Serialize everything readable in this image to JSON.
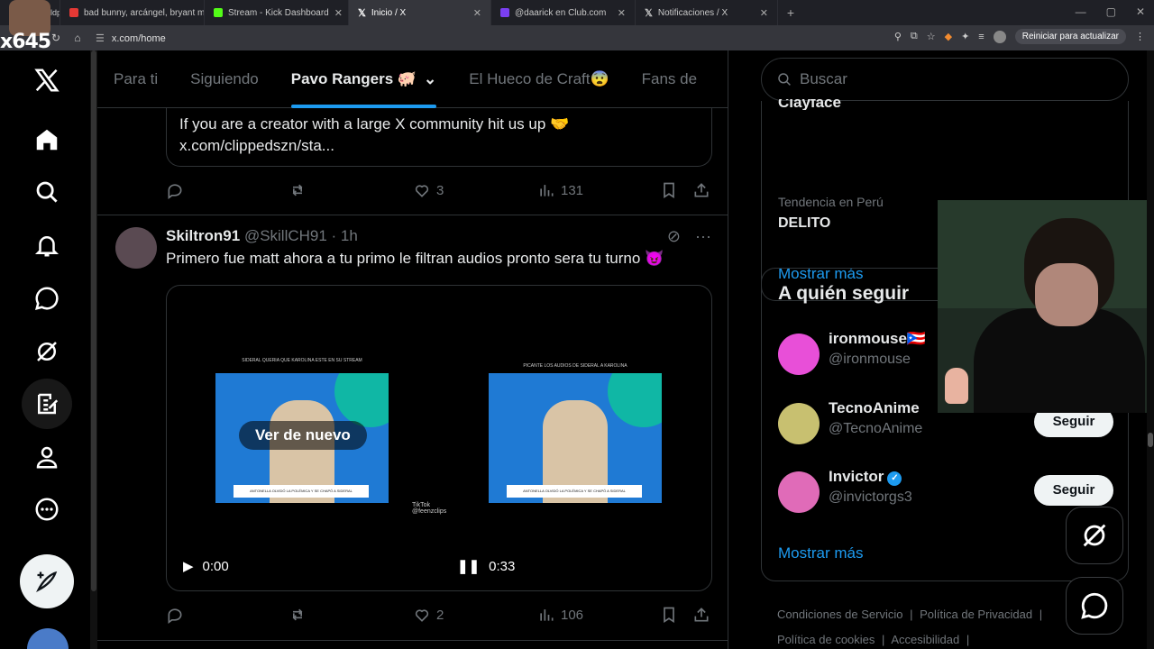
{
  "browser": {
    "tabs": [
      {
        "title": "ldplay - A Sky Full Of Stars (L",
        "color": "#e53935"
      },
      {
        "title": "bad bunny, arcángel, bryant my",
        "color": "#e53935"
      },
      {
        "title": "Stream - Kick Dashboard",
        "color": "#53fc18"
      },
      {
        "title": "Inicio / X",
        "color": "#ffffff"
      },
      {
        "title": "@daarick en Club.com",
        "color": "#7b3ff2"
      },
      {
        "title": "Notificaciones / X",
        "color": "#ffffff"
      }
    ],
    "url": "x.com/home",
    "update_label": "Reiniciar para actualizar"
  },
  "overlay": {
    "brand": "x645"
  },
  "nav": {
    "items": [
      "x-logo-icon",
      "home-icon",
      "search-icon",
      "bell-icon",
      "chat-icon",
      "grok-icon",
      "post-edit-icon",
      "profile-icon",
      "more-icon"
    ]
  },
  "feed": {
    "tabs": [
      {
        "label": "Para ti"
      },
      {
        "label": "Siguiendo"
      },
      {
        "label": "Pavo Rangers 🐖"
      },
      {
        "label": "El Hueco de Craft😨"
      },
      {
        "label": "Fans de"
      }
    ],
    "quoted": {
      "line1": "If you are a creator with a large X community hit us up 🤝",
      "line2": "x.com/clippedszn/sta..."
    },
    "post1_actions": {
      "likes": "3",
      "views": "131"
    },
    "post2": {
      "name": "Skiltron91",
      "handle": "@SkillCH91 · 1h",
      "text": "Primero fue matt ahora a tu primo le filtran audios pronto sera tu turno 😈",
      "video1": {
        "caption": "SIDERAL QUERIA QUE KAROLINA ESTE EN SU STREAM",
        "banner": "ANTONELLA OLVIDÓ LA POLÉMICA Y SE CHAPÓ A SIDERAL",
        "replay": "Ver de nuevo",
        "time": "0:00"
      },
      "video2": {
        "caption": "PICANTE LOS AUDIOS DE SIDERAL A KAROLINA",
        "banner": "ANTONELLA OLVIDÓ LA POLÉMICA Y SE CHAPÓ A SIDERAL",
        "time": "0:33"
      },
      "tiktok": "TikTok",
      "tiktok_handle": "@feenzclips",
      "likes": "2",
      "views": "106"
    }
  },
  "right": {
    "search_placeholder": "Buscar",
    "trend_cut": "Clayface",
    "trend_meta": "Tendencia en Perú",
    "trend_name": "DELITO",
    "show_more": "Mostrar más",
    "follow_title": "A quién seguir",
    "follow": [
      {
        "name": "ironmouse🇵🇷",
        "handle": "@ironmouse",
        "color": "#e84fd8"
      },
      {
        "name": "TecnoAnime",
        "handle": "@TecnoAnime",
        "color": "#c8c070",
        "button": "Seguir"
      },
      {
        "name": "Invictor",
        "handle": "@invictorgs3",
        "color": "#e06bb8",
        "button": "Seguir"
      }
    ],
    "show_more2": "Mostrar más",
    "footer": [
      "Condiciones de Servicio",
      "|",
      "Política de Privacidad",
      "|",
      "Política de cookies",
      "|",
      "Accesibilidad",
      "|"
    ]
  }
}
